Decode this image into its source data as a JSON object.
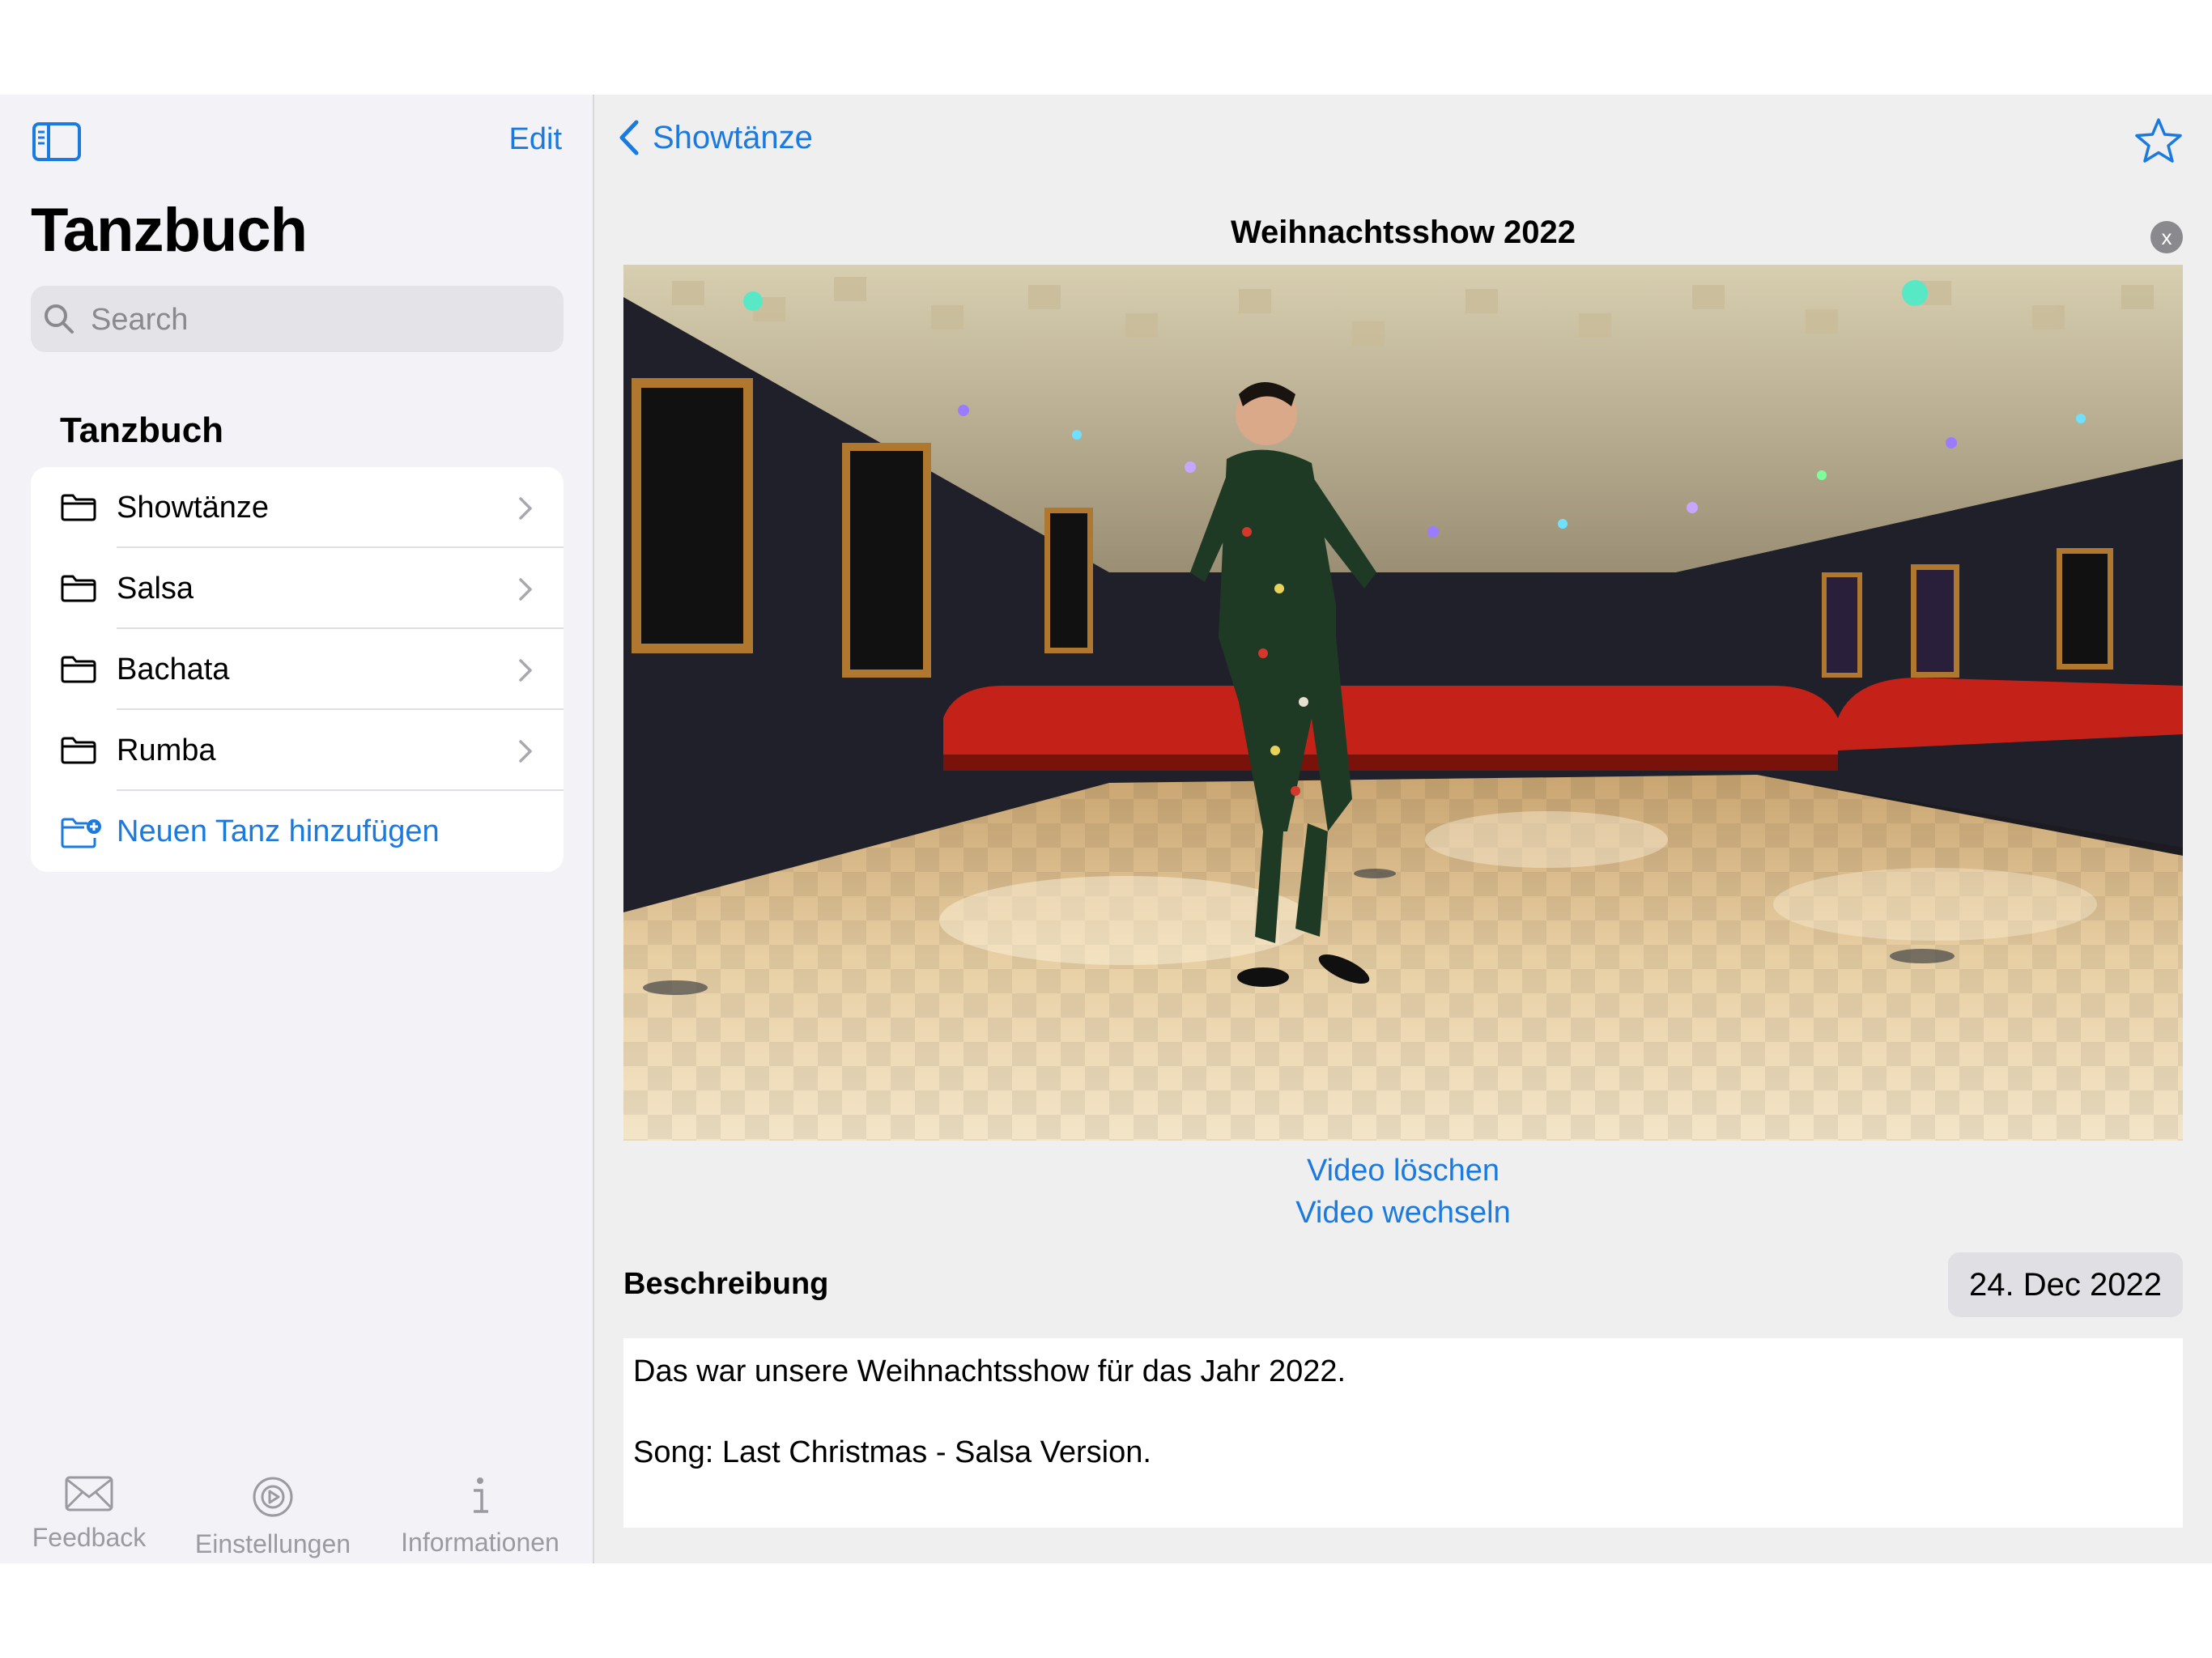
{
  "sidebar": {
    "edit_label": "Edit",
    "title": "Tanzbuch",
    "search_placeholder": "Search",
    "section_header": "Tanzbuch",
    "items": [
      {
        "label": "Showtänze",
        "icon": "folder-icon"
      },
      {
        "label": "Salsa",
        "icon": "folder-icon"
      },
      {
        "label": "Bachata",
        "icon": "folder-icon"
      },
      {
        "label": "Rumba",
        "icon": "folder-icon"
      }
    ],
    "add_label": "Neuen Tanz hinzufügen"
  },
  "tabbar": {
    "tabs": [
      {
        "label": "Feedback",
        "icon": "envelope-icon"
      },
      {
        "label": "Einstellungen",
        "icon": "settings-icon"
      },
      {
        "label": "Informationen",
        "icon": "info-icon"
      }
    ]
  },
  "main": {
    "back_label": "Showtänze",
    "video_title": "Weihnachtsshow 2022",
    "close_glyph": "x",
    "delete_video_label": "Video löschen",
    "change_video_label": "Video wechseln",
    "description_label": "Beschreibung",
    "date": "24. Dec 2022",
    "description_lines": [
      "Das war unsere Weihnachtsshow für das Jahr 2022.",
      "Song: Last Christmas - Salsa Version."
    ]
  },
  "colors": {
    "accent": "#1a7ae0",
    "sidebar_bg": "#f2f2f7",
    "main_bg": "#efefef"
  }
}
